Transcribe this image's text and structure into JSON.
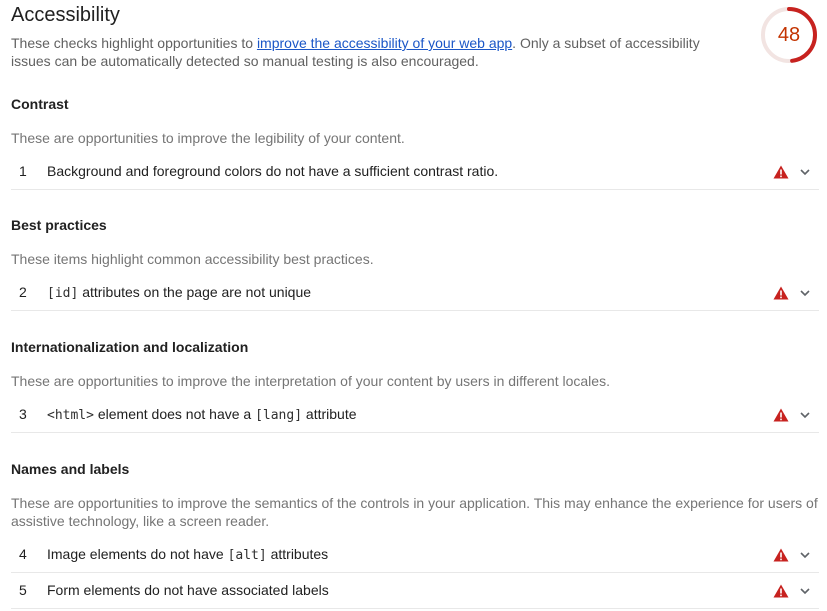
{
  "header": {
    "title": "Accessibility",
    "desc_before": "These checks highlight opportunities to ",
    "desc_link": "improve the accessibility of your web app",
    "desc_after": ". Only a subset of accessibility issues can be automatically detected so manual testing is also encouraged.",
    "score": "48"
  },
  "colors": {
    "fail": "#c7221f",
    "score_text": "#c33300",
    "link": "#1a56c7"
  },
  "groups": [
    {
      "title": "Contrast",
      "description": "These are opportunities to improve the legibility of your content.",
      "audits": [
        {
          "index": "1",
          "title_parts": [
            {
              "text": "Background and foreground colors do not have a sufficient contrast ratio."
            }
          ],
          "status_icon": "warning-triangle-icon"
        }
      ]
    },
    {
      "title": "Best practices",
      "description": "These items highlight common accessibility best practices.",
      "audits": [
        {
          "index": "2",
          "title_parts": [
            {
              "text": "[id]",
              "code": true
            },
            {
              "text": " attributes on the page are not unique"
            }
          ],
          "status_icon": "warning-triangle-icon"
        }
      ]
    },
    {
      "title": "Internationalization and localization",
      "description": "These are opportunities to improve the interpretation of your content by users in different locales.",
      "audits": [
        {
          "index": "3",
          "title_parts": [
            {
              "text": "<html>",
              "code": true
            },
            {
              "text": " element does not have a "
            },
            {
              "text": "[lang]",
              "code": true
            },
            {
              "text": " attribute"
            }
          ],
          "status_icon": "warning-triangle-icon"
        }
      ]
    },
    {
      "title": "Names and labels",
      "description": "These are opportunities to improve the semantics of the controls in your application. This may enhance the experience for users of assistive technology, like a screen reader.",
      "audits": [
        {
          "index": "4",
          "title_parts": [
            {
              "text": "Image elements do not have "
            },
            {
              "text": "[alt]",
              "code": true
            },
            {
              "text": " attributes"
            }
          ],
          "status_icon": "warning-triangle-icon"
        },
        {
          "index": "5",
          "title_parts": [
            {
              "text": "Form elements do not have associated labels"
            }
          ],
          "status_icon": "warning-triangle-icon"
        }
      ]
    }
  ]
}
